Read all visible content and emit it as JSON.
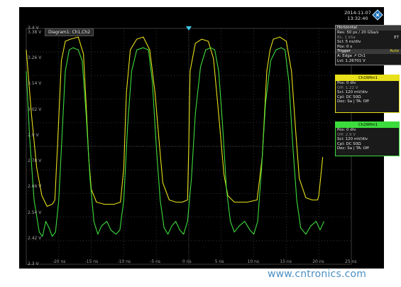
{
  "header": {
    "date": "2014-11-07",
    "time": "13:32:40"
  },
  "diagram_title": "Diagram1: Ch1,Ch2",
  "horizontal": {
    "title": "Horizontal",
    "res": "Res: 50 ps / 20 GSa/s",
    "rl": "RL: 1 kSa",
    "et": "ET",
    "scl": "Scl: 5 ns/div",
    "pos": "Pos: 0 s"
  },
  "trigger": {
    "title": "Trigger",
    "mode": "Auto",
    "source": "A:  Edge ↗ Ch1",
    "level": "Lvl: 1.26701 V"
  },
  "ch1": {
    "title": "Ch1Wfm1",
    "pos": "Pos: 0 div",
    "off": "Off: 1.22 V",
    "scl": "Scl: 120 mV/div",
    "cpl": "Cpl: DC 50Ω",
    "dec": "Dec: Sa | TA: Off",
    "color": "#e8e01a"
  },
  "ch2": {
    "title": "Ch2Wfm1",
    "pos": "Pos: 0 div",
    "off": "Off: 2.9 V",
    "scl": "Scl: 120 mV/div",
    "cpl": "Cpl: DC 50Ω",
    "dec": "Dec: Sa | TA: Off",
    "color": "#3ddc3d"
  },
  "watermark": "www.cntronics.com",
  "chart_data": {
    "type": "line",
    "xlabel": "",
    "ylabel": "",
    "x_unit": "ns",
    "xlim": [
      -25,
      25
    ],
    "ylim": [
      2.3,
      3.4
    ],
    "x_tick_labels": [
      "-20 ns",
      "-15 ns",
      "-10 ns",
      "-5 ns",
      "0 ns",
      "5 ns",
      "10 ns",
      "15 ns",
      "20 ns",
      "25 ns"
    ],
    "x_tick_values": [
      -20,
      -15,
      -10,
      -5,
      0,
      5,
      10,
      15,
      20,
      25
    ],
    "y_tick_labels": [
      "3.4 V",
      "3.38 V",
      "3.26 V",
      "3.14 V",
      "3.02 V",
      "2.9 V",
      "2.78 V",
      "2.66 V",
      "2.54 V",
      "2.42 V",
      "2.3 V"
    ],
    "y_tick_values": [
      3.4,
      3.38,
      3.26,
      3.14,
      3.02,
      2.9,
      2.78,
      2.66,
      2.54,
      2.42,
      2.3
    ],
    "grid": true,
    "series": [
      {
        "name": "Ch1Wfm1",
        "color": "#e8e01a",
        "x": [
          -25,
          -24.2,
          -23.4,
          -22.6,
          -21.8,
          -21.0,
          -20.6,
          -20.2,
          -19.6,
          -19.0,
          -18.2,
          -17.0,
          -16.2,
          -15.8,
          -15.4,
          -15.0,
          -14.2,
          -13.0,
          -11.5,
          -10.5,
          -10.0,
          -9.6,
          -9.0,
          -8.0,
          -7.0,
          -6.0,
          -5.2,
          -4.5,
          -4.0,
          -3.0,
          -2.0,
          -1.0,
          -0.2,
          0.0,
          0.2,
          1.0,
          2.0,
          3.0,
          3.8,
          4.6,
          5.4,
          6.0,
          7.0,
          9.0,
          10.5,
          11.3,
          12.0,
          12.5,
          13.0,
          14.0,
          15.0,
          15.8,
          16.5,
          17.0,
          18.0,
          19.0,
          19.8,
          20.0,
          20.6
        ],
        "y": [
          3.3,
          3.0,
          2.75,
          2.62,
          2.57,
          2.58,
          2.6,
          2.85,
          3.25,
          3.34,
          3.35,
          3.36,
          3.28,
          3.05,
          2.8,
          2.65,
          2.59,
          2.58,
          2.58,
          2.59,
          2.75,
          3.1,
          3.3,
          3.35,
          3.36,
          3.3,
          3.1,
          2.85,
          2.68,
          2.6,
          2.59,
          2.59,
          2.6,
          2.85,
          3.2,
          3.33,
          3.35,
          3.34,
          3.26,
          3.0,
          2.72,
          2.62,
          2.59,
          2.59,
          2.6,
          2.8,
          3.2,
          3.3,
          3.35,
          3.36,
          3.34,
          3.2,
          2.9,
          2.7,
          2.61,
          2.6,
          2.6,
          2.62,
          2.8
        ]
      },
      {
        "name": "Ch2Wfm1",
        "color": "#3ddc3d",
        "x": [
          -25,
          -24.5,
          -23.8,
          -23.0,
          -22.5,
          -22.0,
          -21.5,
          -21.0,
          -20.5,
          -20.0,
          -19.5,
          -19.0,
          -18.4,
          -17.8,
          -17.0,
          -16.4,
          -15.8,
          -15.2,
          -14.6,
          -14.0,
          -13.4,
          -12.6,
          -12.0,
          -11.2,
          -10.6,
          -10.0,
          -9.4,
          -8.8,
          -8.0,
          -7.0,
          -6.2,
          -5.6,
          -5.0,
          -4.4,
          -3.8,
          -3.2,
          -2.6,
          -2.0,
          -1.4,
          -0.8,
          -0.2,
          0.4,
          1.0,
          1.8,
          2.6,
          3.4,
          4.0,
          4.6,
          5.2,
          5.8,
          6.4,
          7.0,
          7.8,
          8.6,
          9.4,
          10.0,
          10.6,
          11.2,
          11.8,
          12.6,
          13.4,
          14.2,
          14.8,
          15.4,
          16.0,
          16.6,
          17.2,
          18.0,
          18.8,
          19.6,
          20.2,
          20.8
        ],
        "y": [
          3.2,
          2.9,
          2.6,
          2.45,
          2.43,
          2.5,
          2.47,
          2.43,
          2.45,
          2.6,
          2.9,
          3.2,
          3.3,
          3.31,
          3.3,
          3.25,
          3.0,
          2.7,
          2.5,
          2.44,
          2.48,
          2.5,
          2.46,
          2.44,
          2.46,
          2.6,
          2.95,
          3.2,
          3.3,
          3.31,
          3.3,
          3.15,
          2.85,
          2.6,
          2.47,
          2.44,
          2.48,
          2.5,
          2.46,
          2.44,
          2.5,
          2.7,
          3.0,
          3.22,
          3.3,
          3.31,
          3.3,
          3.2,
          2.95,
          2.65,
          2.5,
          2.45,
          2.48,
          2.5,
          2.46,
          2.44,
          2.5,
          2.75,
          3.05,
          3.25,
          3.3,
          3.31,
          3.3,
          3.15,
          2.85,
          2.6,
          2.47,
          2.44,
          2.48,
          2.5,
          2.46,
          2.5
        ]
      }
    ]
  }
}
